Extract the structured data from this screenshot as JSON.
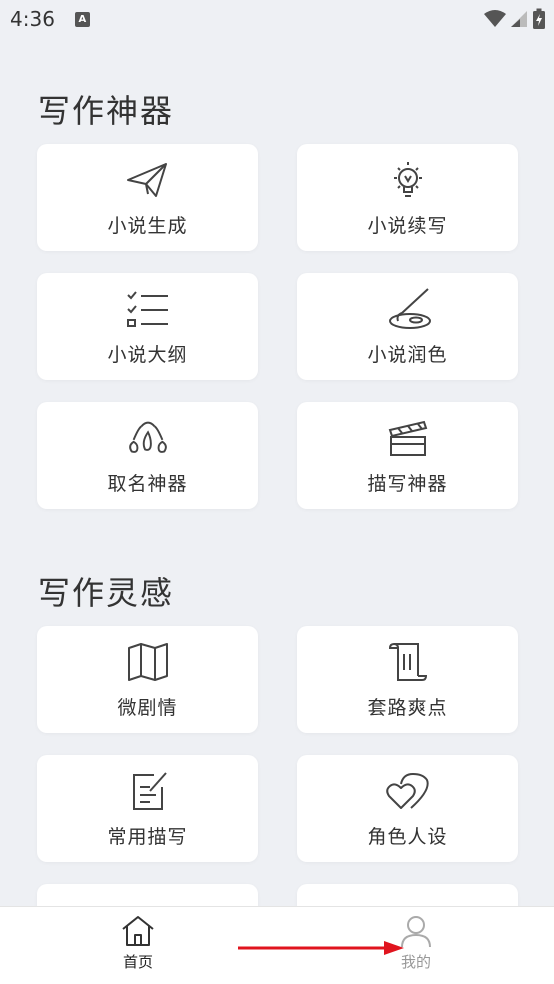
{
  "status": {
    "time": "4:36",
    "notif_letter": "A"
  },
  "section1": {
    "title": "写作神器",
    "items": [
      {
        "label": "小说生成",
        "icon": "paper-plane-icon"
      },
      {
        "label": "小说续写",
        "icon": "light-bulb-icon"
      },
      {
        "label": "小说大纲",
        "icon": "checklist-icon"
      },
      {
        "label": "小说润色",
        "icon": "paint-palette-icon"
      },
      {
        "label": "取名神器",
        "icon": "crown-drops-icon"
      },
      {
        "label": "描写神器",
        "icon": "clapperboard-icon"
      }
    ]
  },
  "section2": {
    "title": "写作灵感",
    "items": [
      {
        "label": "微剧情",
        "icon": "map-icon"
      },
      {
        "label": "套路爽点",
        "icon": "scroll-icon"
      },
      {
        "label": "常用描写",
        "icon": "edit-note-icon"
      },
      {
        "label": "角色人设",
        "icon": "hearts-icon"
      }
    ]
  },
  "tabbar": {
    "home_label": "首页",
    "mine_label": "我的"
  },
  "colors": {
    "background": "#eef0f4",
    "card": "#ffffff",
    "arrow": "#e0141e"
  }
}
